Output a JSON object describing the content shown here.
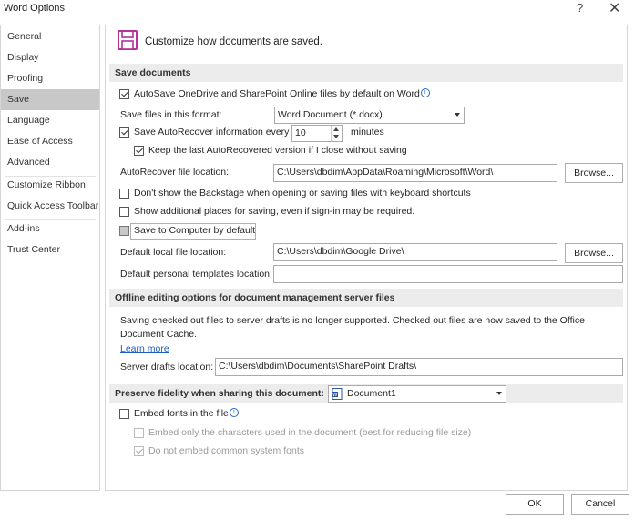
{
  "window": {
    "title": "Word Options",
    "help": "?",
    "close": "✕"
  },
  "sidebar": {
    "items": [
      {
        "label": "General"
      },
      {
        "label": "Display"
      },
      {
        "label": "Proofing"
      },
      {
        "label": "Save"
      },
      {
        "label": "Language"
      },
      {
        "label": "Ease of Access"
      },
      {
        "label": "Advanced"
      },
      {
        "label": "Customize Ribbon"
      },
      {
        "label": "Quick Access Toolbar"
      },
      {
        "label": "Add-ins"
      },
      {
        "label": "Trust Center"
      }
    ]
  },
  "header": {
    "text": "Customize how documents are saved.",
    "icon": "floppy-disk-icon"
  },
  "save_documents": {
    "section_title": "Save documents",
    "autosave_label": "AutoSave OneDrive and SharePoint Online files by default on Word",
    "format_label": "Save files in this format:",
    "format_value": "Word Document (*.docx)",
    "autorecover_label": "Save AutoRecover information every",
    "autorecover_minutes": "10",
    "minutes_label": "minutes",
    "keep_last_label": "Keep the last AutoRecovered version if I close without saving",
    "autorecover_location_label": "AutoRecover file location:",
    "autorecover_location_value": "C:\\Users\\dbdim\\AppData\\Roaming\\Microsoft\\Word\\",
    "browse_label": "Browse...",
    "backstage_label": "Don't show the Backstage when opening or saving files with keyboard shortcuts",
    "additional_places_label": "Show additional places for saving, even if sign-in may be required.",
    "save_to_computer_label": "Save to Computer by default",
    "default_local_label": "Default local file location:",
    "default_local_value": "C:\\Users\\dbdim\\Google Drive\\",
    "browse2_label": "Browse...",
    "templates_label": "Default personal templates location:",
    "templates_value": ""
  },
  "offline": {
    "section_title": "Offline editing options for document management server files",
    "notice": "Saving checked out files to server drafts is no longer supported. Checked out files are now saved to the Office Document Cache.",
    "learn_more": "Learn more",
    "drafts_label": "Server drafts location:",
    "drafts_value": "C:\\Users\\dbdim\\Documents\\SharePoint Drafts\\"
  },
  "fidelity": {
    "section_title": "Preserve fidelity when sharing this document:",
    "document_value": "Document1",
    "embed_fonts_label": "Embed fonts in the file",
    "embed_chars_label": "Embed only the characters used in the document (best for reducing file size)",
    "no_common_label": "Do not embed common system fonts"
  },
  "footer": {
    "ok_label": "OK",
    "cancel_label": "Cancel"
  },
  "colors": {
    "accent": "#b4309a",
    "selected_nav": "#c8c8c8",
    "section_bg": "#ececec",
    "link": "#1f5fbf"
  }
}
